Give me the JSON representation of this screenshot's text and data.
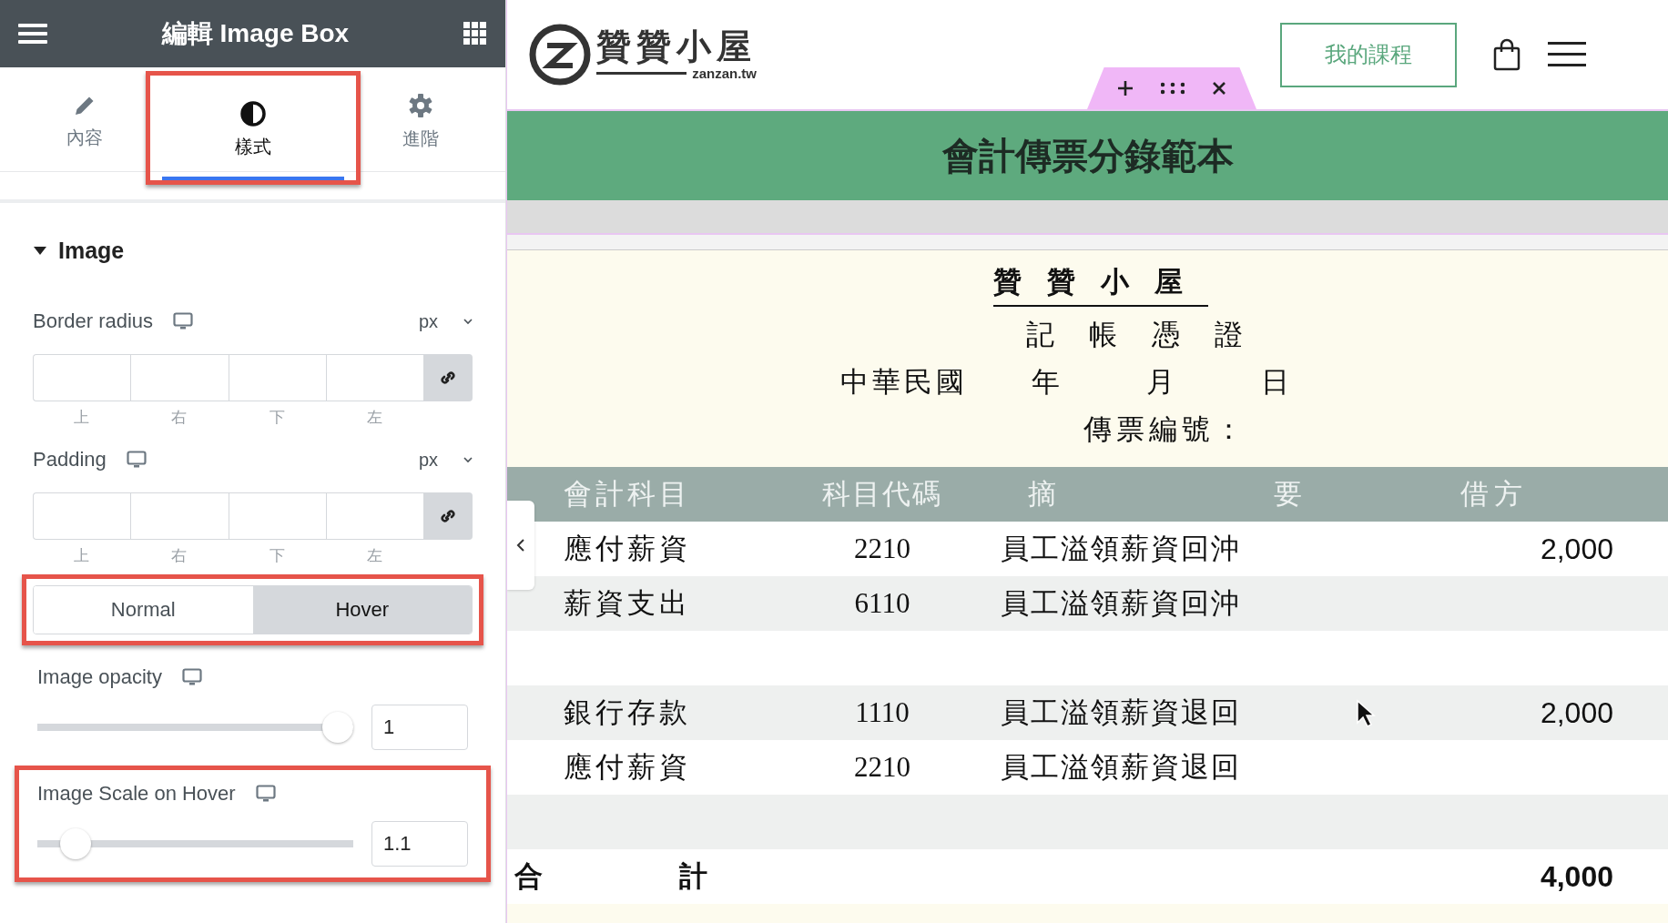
{
  "editor": {
    "title": "編輯 Image Box",
    "tabs": [
      {
        "label": "內容",
        "selected": false,
        "highlighted": false
      },
      {
        "label": "樣式",
        "selected": true,
        "highlighted": true
      },
      {
        "label": "進階",
        "selected": false,
        "highlighted": false
      }
    ],
    "section": {
      "title": "Image",
      "expanded": true
    },
    "controls": [
      {
        "kind": "dimensions",
        "label": "Border radius",
        "unit": "px",
        "sides": [
          "上",
          "右",
          "下",
          "左"
        ]
      },
      {
        "kind": "dimensions",
        "label": "Padding",
        "unit": "px",
        "sides": [
          "上",
          "右",
          "下",
          "左"
        ]
      },
      {
        "kind": "toggle",
        "highlighted": true,
        "options": [
          {
            "label": "Normal",
            "selected": false
          },
          {
            "label": "Hover",
            "selected": true
          }
        ]
      },
      {
        "kind": "slider",
        "label": "Image opacity",
        "level": 1,
        "value": "1",
        "highlighted": false
      },
      {
        "kind": "slider",
        "label": "Image Scale on Hover",
        "level": 0.08,
        "value": "1.1",
        "highlighted": true
      }
    ]
  },
  "site": {
    "logo": {
      "name": "贊贊小屋",
      "domain": "zanzan.tw"
    },
    "course_button": "我的課程",
    "title": "會計傳票分錄範本",
    "voucher": {
      "company": "贊贊小屋",
      "form_title": "記帳憑證",
      "date_parts": [
        "中華民國",
        "年",
        "月",
        "日"
      ],
      "number_label": "傳票編號："
    },
    "table": {
      "columns": [
        "會計科目",
        "科目代碼",
        "摘",
        "要",
        "借方"
      ],
      "rows": [
        {
          "kind": "entry",
          "account": "應付薪資",
          "code": "2210",
          "memo": "員工溢領薪資回沖",
          "debit": "2,000"
        },
        {
          "kind": "entry",
          "account": "薪資支出",
          "code": "6110",
          "memo": "員工溢領薪資回沖"
        },
        {
          "kind": "spacer"
        },
        {
          "kind": "entry",
          "account": "銀行存款",
          "code": "1110",
          "memo": "員工溢領薪資退回",
          "debit": "2,000"
        },
        {
          "kind": "entry",
          "account": "應付薪資",
          "code": "2210",
          "memo": "員工溢領薪資退回"
        },
        {
          "kind": "spacer"
        }
      ],
      "total": {
        "label": "合計",
        "amount": "4,000"
      }
    }
  }
}
